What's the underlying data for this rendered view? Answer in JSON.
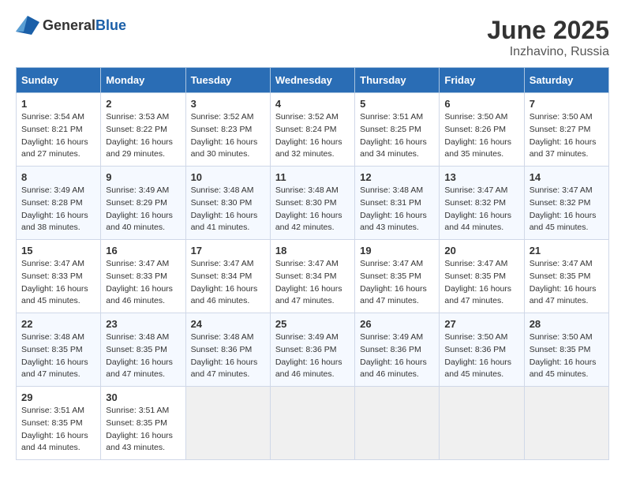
{
  "header": {
    "logo_general": "General",
    "logo_blue": "Blue",
    "month": "June 2025",
    "location": "Inzhavino, Russia"
  },
  "days_of_week": [
    "Sunday",
    "Monday",
    "Tuesday",
    "Wednesday",
    "Thursday",
    "Friday",
    "Saturday"
  ],
  "weeks": [
    [
      {
        "day": "1",
        "sunrise": "Sunrise: 3:54 AM",
        "sunset": "Sunset: 8:21 PM",
        "daylight": "Daylight: 16 hours and 27 minutes."
      },
      {
        "day": "2",
        "sunrise": "Sunrise: 3:53 AM",
        "sunset": "Sunset: 8:22 PM",
        "daylight": "Daylight: 16 hours and 29 minutes."
      },
      {
        "day": "3",
        "sunrise": "Sunrise: 3:52 AM",
        "sunset": "Sunset: 8:23 PM",
        "daylight": "Daylight: 16 hours and 30 minutes."
      },
      {
        "day": "4",
        "sunrise": "Sunrise: 3:52 AM",
        "sunset": "Sunset: 8:24 PM",
        "daylight": "Daylight: 16 hours and 32 minutes."
      },
      {
        "day": "5",
        "sunrise": "Sunrise: 3:51 AM",
        "sunset": "Sunset: 8:25 PM",
        "daylight": "Daylight: 16 hours and 34 minutes."
      },
      {
        "day": "6",
        "sunrise": "Sunrise: 3:50 AM",
        "sunset": "Sunset: 8:26 PM",
        "daylight": "Daylight: 16 hours and 35 minutes."
      },
      {
        "day": "7",
        "sunrise": "Sunrise: 3:50 AM",
        "sunset": "Sunset: 8:27 PM",
        "daylight": "Daylight: 16 hours and 37 minutes."
      }
    ],
    [
      {
        "day": "8",
        "sunrise": "Sunrise: 3:49 AM",
        "sunset": "Sunset: 8:28 PM",
        "daylight": "Daylight: 16 hours and 38 minutes."
      },
      {
        "day": "9",
        "sunrise": "Sunrise: 3:49 AM",
        "sunset": "Sunset: 8:29 PM",
        "daylight": "Daylight: 16 hours and 40 minutes."
      },
      {
        "day": "10",
        "sunrise": "Sunrise: 3:48 AM",
        "sunset": "Sunset: 8:30 PM",
        "daylight": "Daylight: 16 hours and 41 minutes."
      },
      {
        "day": "11",
        "sunrise": "Sunrise: 3:48 AM",
        "sunset": "Sunset: 8:30 PM",
        "daylight": "Daylight: 16 hours and 42 minutes."
      },
      {
        "day": "12",
        "sunrise": "Sunrise: 3:48 AM",
        "sunset": "Sunset: 8:31 PM",
        "daylight": "Daylight: 16 hours and 43 minutes."
      },
      {
        "day": "13",
        "sunrise": "Sunrise: 3:47 AM",
        "sunset": "Sunset: 8:32 PM",
        "daylight": "Daylight: 16 hours and 44 minutes."
      },
      {
        "day": "14",
        "sunrise": "Sunrise: 3:47 AM",
        "sunset": "Sunset: 8:32 PM",
        "daylight": "Daylight: 16 hours and 45 minutes."
      }
    ],
    [
      {
        "day": "15",
        "sunrise": "Sunrise: 3:47 AM",
        "sunset": "Sunset: 8:33 PM",
        "daylight": "Daylight: 16 hours and 45 minutes."
      },
      {
        "day": "16",
        "sunrise": "Sunrise: 3:47 AM",
        "sunset": "Sunset: 8:33 PM",
        "daylight": "Daylight: 16 hours and 46 minutes."
      },
      {
        "day": "17",
        "sunrise": "Sunrise: 3:47 AM",
        "sunset": "Sunset: 8:34 PM",
        "daylight": "Daylight: 16 hours and 46 minutes."
      },
      {
        "day": "18",
        "sunrise": "Sunrise: 3:47 AM",
        "sunset": "Sunset: 8:34 PM",
        "daylight": "Daylight: 16 hours and 47 minutes."
      },
      {
        "day": "19",
        "sunrise": "Sunrise: 3:47 AM",
        "sunset": "Sunset: 8:35 PM",
        "daylight": "Daylight: 16 hours and 47 minutes."
      },
      {
        "day": "20",
        "sunrise": "Sunrise: 3:47 AM",
        "sunset": "Sunset: 8:35 PM",
        "daylight": "Daylight: 16 hours and 47 minutes."
      },
      {
        "day": "21",
        "sunrise": "Sunrise: 3:47 AM",
        "sunset": "Sunset: 8:35 PM",
        "daylight": "Daylight: 16 hours and 47 minutes."
      }
    ],
    [
      {
        "day": "22",
        "sunrise": "Sunrise: 3:48 AM",
        "sunset": "Sunset: 8:35 PM",
        "daylight": "Daylight: 16 hours and 47 minutes."
      },
      {
        "day": "23",
        "sunrise": "Sunrise: 3:48 AM",
        "sunset": "Sunset: 8:35 PM",
        "daylight": "Daylight: 16 hours and 47 minutes."
      },
      {
        "day": "24",
        "sunrise": "Sunrise: 3:48 AM",
        "sunset": "Sunset: 8:36 PM",
        "daylight": "Daylight: 16 hours and 47 minutes."
      },
      {
        "day": "25",
        "sunrise": "Sunrise: 3:49 AM",
        "sunset": "Sunset: 8:36 PM",
        "daylight": "Daylight: 16 hours and 46 minutes."
      },
      {
        "day": "26",
        "sunrise": "Sunrise: 3:49 AM",
        "sunset": "Sunset: 8:36 PM",
        "daylight": "Daylight: 16 hours and 46 minutes."
      },
      {
        "day": "27",
        "sunrise": "Sunrise: 3:50 AM",
        "sunset": "Sunset: 8:36 PM",
        "daylight": "Daylight: 16 hours and 45 minutes."
      },
      {
        "day": "28",
        "sunrise": "Sunrise: 3:50 AM",
        "sunset": "Sunset: 8:35 PM",
        "daylight": "Daylight: 16 hours and 45 minutes."
      }
    ],
    [
      {
        "day": "29",
        "sunrise": "Sunrise: 3:51 AM",
        "sunset": "Sunset: 8:35 PM",
        "daylight": "Daylight: 16 hours and 44 minutes."
      },
      {
        "day": "30",
        "sunrise": "Sunrise: 3:51 AM",
        "sunset": "Sunset: 8:35 PM",
        "daylight": "Daylight: 16 hours and 43 minutes."
      },
      {
        "day": "",
        "sunrise": "",
        "sunset": "",
        "daylight": ""
      },
      {
        "day": "",
        "sunrise": "",
        "sunset": "",
        "daylight": ""
      },
      {
        "day": "",
        "sunrise": "",
        "sunset": "",
        "daylight": ""
      },
      {
        "day": "",
        "sunrise": "",
        "sunset": "",
        "daylight": ""
      },
      {
        "day": "",
        "sunrise": "",
        "sunset": "",
        "daylight": ""
      }
    ]
  ]
}
